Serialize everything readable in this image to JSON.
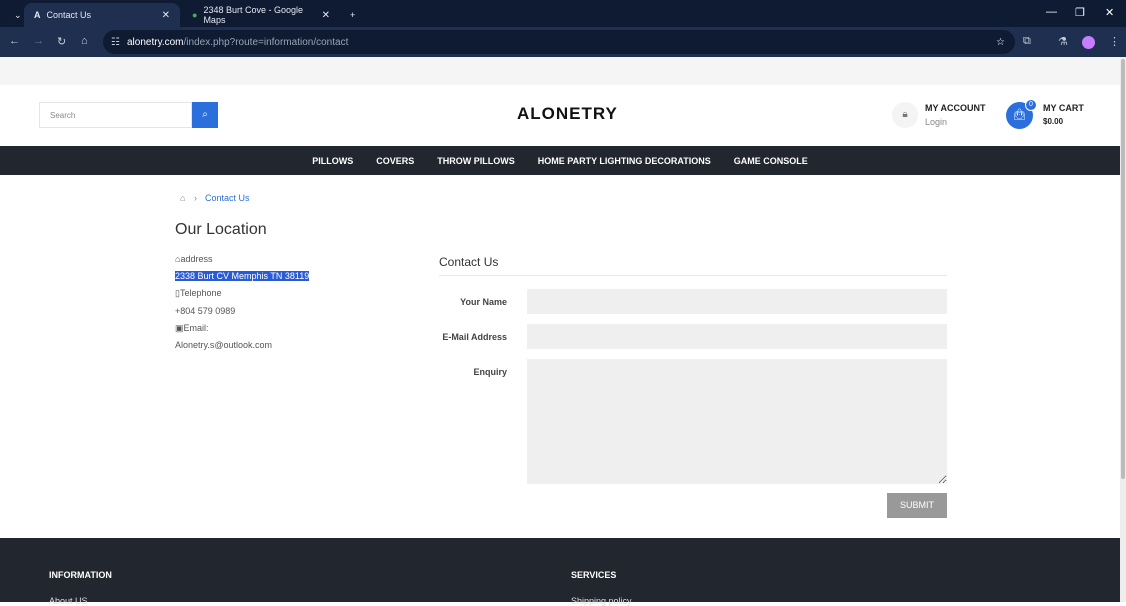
{
  "browser": {
    "tabs": [
      {
        "title": "Contact Us"
      },
      {
        "title": "2348 Burt Cove - Google Maps"
      }
    ],
    "url_domain": "alonetry.com",
    "url_path": "/index.php?route=information/contact"
  },
  "header": {
    "search_placeholder": "Search",
    "logo": "ALONETRY",
    "account_label": "MY ACCOUNT",
    "login_label": "Login",
    "cart_label": "MY CART",
    "cart_total": "$0.00",
    "cart_count": "0"
  },
  "menu": [
    "PILLOWS",
    "COVERS",
    "THROW PILLOWS",
    "HOME PARTY LIGHTING DECORATIONS",
    "GAME CONSOLE"
  ],
  "breadcrumb": {
    "current": "Contact Us"
  },
  "location": {
    "title": "Our Location",
    "address_label": "address",
    "address": "2338 Burt CV Memphis TN 38119",
    "telephone_label": "Telephone",
    "telephone": "+804 579 0989",
    "email_label": "Email:",
    "email": "Alonetry.s@outlook.com"
  },
  "form": {
    "title": "Contact Us",
    "name_label": "Your Name",
    "email_label": "E-Mail Address",
    "enquiry_label": "Enquiry",
    "submit": "SUBMIT"
  },
  "footer": {
    "information": "INFORMATION",
    "services": "SERVICES",
    "info_link": "About US",
    "services_link": "Shipping policy"
  }
}
